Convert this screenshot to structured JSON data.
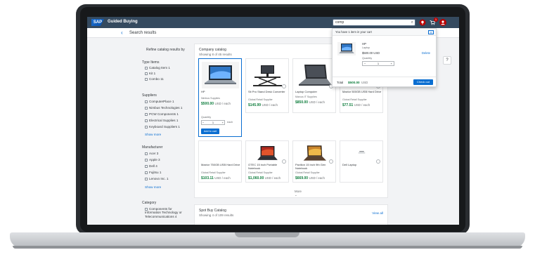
{
  "shell": {
    "logo": "SAP",
    "app_title": "Guided Buying",
    "search_value": "comp",
    "cart_count": "1"
  },
  "subheader": {
    "title": "Search results"
  },
  "filters": {
    "refine_title": "Refine catalog results by",
    "type": {
      "heading": "Type Items",
      "items": [
        {
          "label": "Catalog Item",
          "count": "1"
        },
        {
          "label": "Kit",
          "count": "1"
        },
        {
          "label": "Combo",
          "count": "11"
        }
      ]
    },
    "suppliers": {
      "heading": "Suppliers",
      "items": [
        {
          "label": "ComputerPlace",
          "count": "1"
        },
        {
          "label": "Nimbus Technologies",
          "count": "1"
        },
        {
          "label": "PCW Components",
          "count": "1"
        },
        {
          "label": "Electrical Supplies",
          "count": "1"
        },
        {
          "label": "Keyboard Suppliers",
          "count": "1"
        }
      ],
      "show_more": "Show more"
    },
    "manufacturer": {
      "heading": "Manufacturer",
      "items": [
        {
          "label": "Acer",
          "count": "3"
        },
        {
          "label": "Apple",
          "count": "3"
        },
        {
          "label": "Dell",
          "count": "4"
        },
        {
          "label": "Fujitsu",
          "count": "1"
        },
        {
          "label": "Lenovo Inc.",
          "count": "1"
        }
      ],
      "show_more": "Show more"
    },
    "category": {
      "heading": "Category",
      "items": [
        {
          "label": "Components for Information Technology or Telecommunications",
          "count": "4"
        }
      ]
    }
  },
  "catalog": {
    "title": "Company catalog",
    "count": "Showing 8 of 45 results",
    "more": "More",
    "products": [
      {
        "name": "HP",
        "supplier": "Nimbus Supplies",
        "price": "$500.00",
        "unit": "USD / each"
      },
      {
        "name": "Sit Pro Stand Desk Converter",
        "supplier": "Global Retail Supplier",
        "price": "$145.99",
        "unit": "USD / each"
      },
      {
        "name": "Laptop Computer",
        "supplier": "Marcus IT Supplies",
        "price": "$850.00",
        "unit": "USD / each"
      },
      {
        "name": "Maxtor 500GB USB Hard Drive",
        "supplier": "Global Retail Supplier",
        "price": "$77.51",
        "unit": "USD / each"
      },
      {
        "name": "Maxtor 750GB USB Hard Drive",
        "supplier": "Global Retail Supplier",
        "price": "$103.11",
        "unit": "USD / each"
      },
      {
        "name": "OTEC 15 inch Portable Notebook",
        "supplier": "Global Retail Supplier",
        "price": "$1,060.00",
        "unit": "USD / each"
      },
      {
        "name": "Pavilion 15 inch 9th Gen Notebook",
        "supplier": "Global Retail Supplier",
        "price": "$669.00",
        "unit": "USD / each"
      },
      {
        "name": "Dell Laptop",
        "supplier": "",
        "price": "",
        "unit": ""
      }
    ],
    "selected": {
      "quantity_label": "Quantity",
      "quantity": "1",
      "each": "each",
      "add_button": "Add to cart"
    }
  },
  "spot_buy": {
    "title": "Spot Buy Catalog",
    "count": "Showing 4 of 109 results",
    "view_all": "View all"
  },
  "cart_popover": {
    "header": "You have 1 item in your cart",
    "close": "×",
    "item_name": "HP",
    "item_supplier": "Laptop",
    "item_price": "$500.00 USD",
    "delete": "Delete",
    "quantity_label": "Quantity",
    "quantity": "1",
    "total_label": "Total",
    "total": "$500.00",
    "total_unit": "USD",
    "checkout": "Check out"
  },
  "help": "?"
}
